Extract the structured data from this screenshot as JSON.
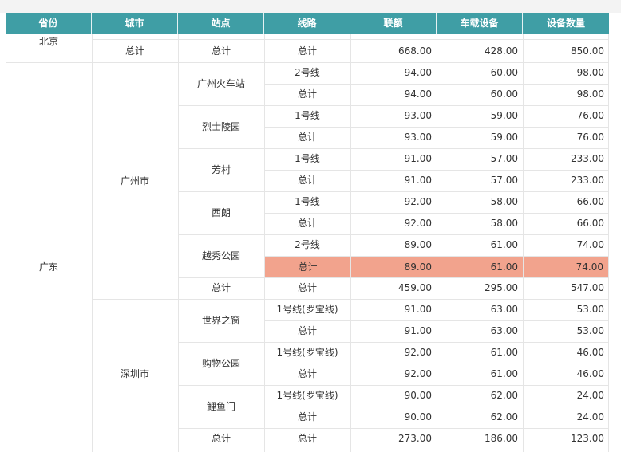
{
  "headers": [
    "省份",
    "城市",
    "站点",
    "线路",
    "联额",
    "车载设备",
    "设备数量"
  ],
  "beijing": {
    "province": "北京",
    "total_label_city": "总计",
    "total_label_station": "总计",
    "total_label_line": "总计",
    "v1": "668.00",
    "v2": "428.00",
    "v3": "850.00"
  },
  "guangdong": {
    "province": "广东",
    "guangzhou": {
      "city": "广州市",
      "stations": [
        {
          "name": "广州火车站",
          "line": "2号线",
          "v": [
            "94.00",
            "60.00",
            "98.00"
          ],
          "total": [
            "94.00",
            "60.00",
            "98.00"
          ]
        },
        {
          "name": "烈士陵园",
          "line": "1号线",
          "v": [
            "93.00",
            "59.00",
            "76.00"
          ],
          "total": [
            "93.00",
            "59.00",
            "76.00"
          ]
        },
        {
          "name": "芳村",
          "line": "1号线",
          "v": [
            "91.00",
            "57.00",
            "233.00"
          ],
          "total": [
            "91.00",
            "57.00",
            "233.00"
          ]
        },
        {
          "name": "西朗",
          "line": "1号线",
          "v": [
            "92.00",
            "58.00",
            "66.00"
          ],
          "total": [
            "92.00",
            "58.00",
            "66.00"
          ]
        },
        {
          "name": "越秀公园",
          "line": "2号线",
          "v": [
            "89.00",
            "61.00",
            "74.00"
          ],
          "total": [
            "89.00",
            "61.00",
            "74.00"
          ]
        }
      ],
      "city_total": [
        "459.00",
        "295.00",
        "547.00"
      ]
    },
    "shenzhen": {
      "city": "深圳市",
      "stations": [
        {
          "name": "世界之窗",
          "line": "1号线(罗宝线)",
          "v": [
            "91.00",
            "63.00",
            "53.00"
          ],
          "total": [
            "91.00",
            "63.00",
            "53.00"
          ]
        },
        {
          "name": "购物公园",
          "line": "1号线(罗宝线)",
          "v": [
            "92.00",
            "61.00",
            "46.00"
          ],
          "total": [
            "92.00",
            "61.00",
            "46.00"
          ]
        },
        {
          "name": "鲤鱼门",
          "line": "1号线(罗宝线)",
          "v": [
            "90.00",
            "62.00",
            "24.00"
          ],
          "total": [
            "90.00",
            "62.00",
            "24.00"
          ]
        }
      ],
      "city_total": [
        "273.00",
        "186.00",
        "123.00"
      ]
    },
    "total_label": "总计"
  },
  "colors": {
    "header_bg": "#3f9ea5",
    "highlight": "#f2a38d",
    "grid": "#e5e5e5"
  }
}
